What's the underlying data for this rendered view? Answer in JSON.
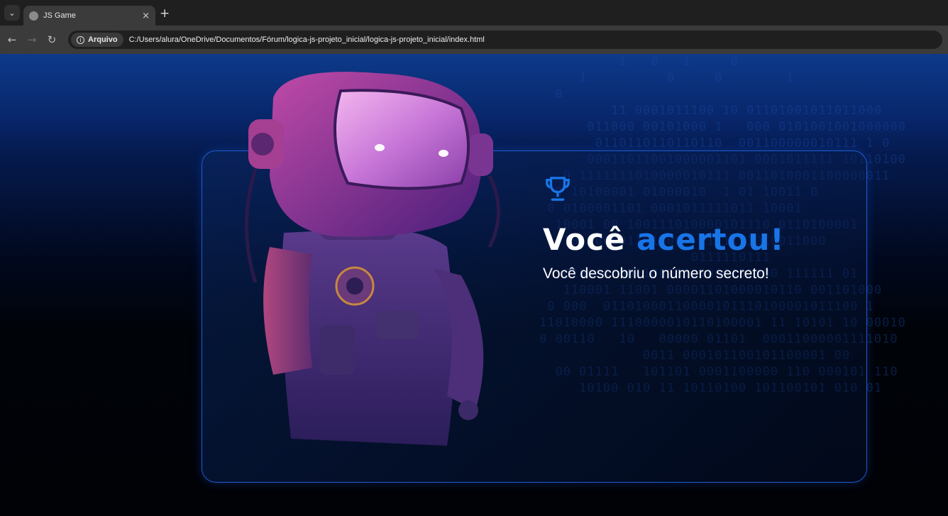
{
  "browser": {
    "tab_title": "JS Game",
    "tab_close": "×",
    "new_tab": "+",
    "site_chip": "Arquivo",
    "url": "C:/Users/alura/OneDrive/Documentos/Fórum/logica-js-projeto_inicial/logica-js-projeto_inicial/index.html"
  },
  "main": {
    "title_part1": "Você ",
    "title_part2": "acertou!",
    "subtitle": "Você descobriu o número secreto!"
  },
  "background_binary": "          1   0   1     0\n     1          0     0        1\n  0\n         11 0001011100 10 01101001011011000\n      011000 00101000 1   000 0101001001000000\n       0110110110110110  001100000010111 1 0\n      00011011001000001101 0001011111 10110100\n   0 1111111010000010111 0011010001100000011\n  0 10100001 01000010  1 01 10011 0\n 0 0100001101 0001011111011 10001\n  10001 00 100111010000101110 0110100001\n  0101000001101000  1111111010011000\n                   0111110111\n   010001100110000001000101000 111111 01\n   110001 11001 00001101000010110 001101000\n 0 000  01101000110000101110100001011100 1\n11010000 1110000010110100001 11 10101 10 00010\n0 00110   10   00000 01101  00011000001111010\n             0011 000101100101100001 00\n  00 01111   101101 0001100000 110 000101 110\n     10100 010 11 10110100 101100101 010 01"
}
